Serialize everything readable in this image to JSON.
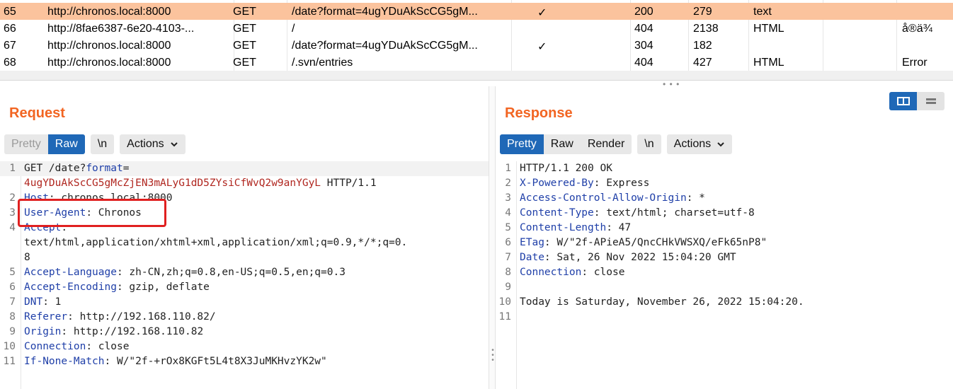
{
  "history": {
    "rows": [
      {
        "num": "65",
        "host": "http://chronos.local:8000",
        "method": "GET",
        "url": "/date?format=4ugYDuAkScCG5gM...",
        "edited": "✓",
        "status": "200",
        "length": "279",
        "mime": "text",
        "title": "",
        "selected": true
      },
      {
        "num": "66",
        "host": "http://8fae6387-6e20-4103-...",
        "method": "GET",
        "url": "/",
        "edited": "",
        "status": "404",
        "length": "2138",
        "mime": "HTML",
        "title": "å®ä¾",
        "selected": false
      },
      {
        "num": "67",
        "host": "http://chronos.local:8000",
        "method": "GET",
        "url": "/date?format=4ugYDuAkScCG5gM...",
        "edited": "✓",
        "status": "304",
        "length": "182",
        "mime": "",
        "title": "",
        "selected": false
      },
      {
        "num": "68",
        "host": "http://chronos.local:8000",
        "method": "GET",
        "url": "/.svn/entries",
        "edited": "",
        "status": "404",
        "length": "427",
        "mime": "HTML",
        "title": "Error",
        "selected": false
      }
    ]
  },
  "request": {
    "title": "Request",
    "tabs": {
      "pretty": "Pretty",
      "raw": "Raw"
    },
    "newline_label": "\\n",
    "actions_label": "Actions",
    "lines": [
      {
        "n": "1",
        "a": "GET /date?",
        "b": "format",
        "c": "="
      },
      {
        "n": "",
        "a": "4ugYDuAkScCG5gMcZjEN3mALyG1dD5ZYsiCfWvQ2w9anYGyL",
        "b": " HTTP/1.1"
      },
      {
        "n": "2",
        "k": "Host",
        "v": ": chronos.local:8000"
      },
      {
        "n": "3",
        "k": "User-Agent",
        "v": ": Chronos"
      },
      {
        "n": "4",
        "k": "Accept",
        "v": ":"
      },
      {
        "n": "",
        "v": "text/html,application/xhtml+xml,application/xml;q=0.9,*/*;q=0."
      },
      {
        "n": "",
        "v": "8"
      },
      {
        "n": "5",
        "k": "Accept-Language",
        "v": ": zh-CN,zh;q=0.8,en-US;q=0.5,en;q=0.3"
      },
      {
        "n": "6",
        "k": "Accept-Encoding",
        "v": ": gzip, deflate"
      },
      {
        "n": "7",
        "k": "DNT",
        "v": ": 1"
      },
      {
        "n": "8",
        "k": "Referer",
        "v": ": http://192.168.110.82/"
      },
      {
        "n": "9",
        "k": "Origin",
        "v": ": http://192.168.110.82"
      },
      {
        "n": "10",
        "k": "Connection",
        "v": ": close"
      },
      {
        "n": "11",
        "k": "If-None-Match",
        "v": ": W/\"2f-+rOx8KGFt5L4t8X3JuMKHvzYK2w\""
      }
    ]
  },
  "response": {
    "title": "Response",
    "tabs": {
      "pretty": "Pretty",
      "raw": "Raw",
      "render": "Render"
    },
    "newline_label": "\\n",
    "actions_label": "Actions",
    "lines": [
      {
        "n": "1",
        "v": "HTTP/1.1 200 OK"
      },
      {
        "n": "2",
        "k": "X-Powered-By",
        "v": ": Express"
      },
      {
        "n": "3",
        "k": "Access-Control-Allow-Origin",
        "v": ": *"
      },
      {
        "n": "4",
        "k": "Content-Type",
        "v": ": text/html; charset=utf-8"
      },
      {
        "n": "5",
        "k": "Content-Length",
        "v": ": 47"
      },
      {
        "n": "6",
        "k": "ETag",
        "v": ": W/\"2f-APieA5/QncCHkVWSXQ/eFk65nP8\""
      },
      {
        "n": "7",
        "k": "Date",
        "v": ": Sat, 26 Nov 2022 15:04:20 GMT"
      },
      {
        "n": "8",
        "k": "Connection",
        "v": ": close"
      },
      {
        "n": "9",
        "v": ""
      },
      {
        "n": "10",
        "v": "Today is Saturday, November 26, 2022 15:04:20."
      },
      {
        "n": "11",
        "v": ""
      }
    ]
  },
  "colors": {
    "accent": "#f26522",
    "selected_row": "#fbc39d",
    "tab_active": "#1f68b7",
    "highlight_box": "#e02020"
  }
}
